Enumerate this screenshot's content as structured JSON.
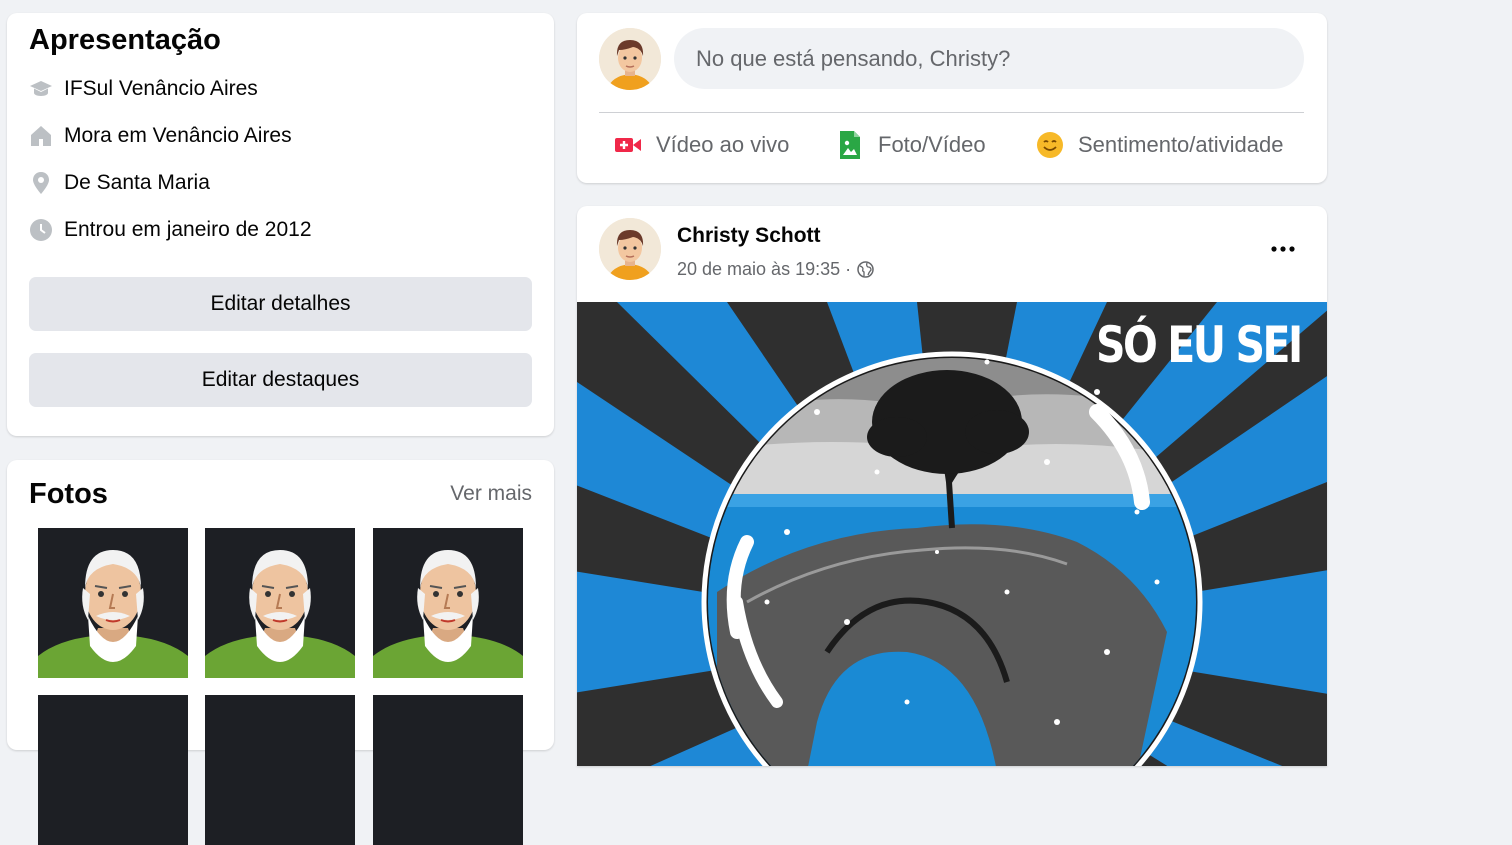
{
  "intro": {
    "title": "Apresentação",
    "items": [
      {
        "icon": "graduation-cap-icon",
        "text": "IFSul Venâncio Aires"
      },
      {
        "icon": "home-icon",
        "text": "Mora em Venâncio Aires"
      },
      {
        "icon": "location-pin-icon",
        "text": "De Santa Maria"
      },
      {
        "icon": "clock-icon",
        "text": "Entrou em janeiro de 2012"
      }
    ],
    "edit_details": "Editar detalhes",
    "edit_highlights": "Editar destaques"
  },
  "photos": {
    "title": "Fotos",
    "see_more": "Ver mais"
  },
  "composer": {
    "placeholder": "No que está pensando, Christy?",
    "actions": [
      {
        "icon": "live-video-icon",
        "label": "Vídeo ao vivo",
        "color": "#f02849"
      },
      {
        "icon": "photo-video-icon",
        "label": "Foto/Vídeo",
        "color": "#45bd62"
      },
      {
        "icon": "feeling-activity-icon",
        "label": "Sentimento/atividade",
        "color": "#f7b928"
      }
    ]
  },
  "post": {
    "author": "Christy Schott",
    "timestamp": "20 de maio às 19:35 ·",
    "privacy_icon": "globe-icon",
    "image_text": "SÓ EU SEI"
  },
  "colors": {
    "background": "#f0f2f5",
    "card": "#ffffff",
    "button": "#e4e6eb",
    "secondary_text": "#65676b"
  }
}
